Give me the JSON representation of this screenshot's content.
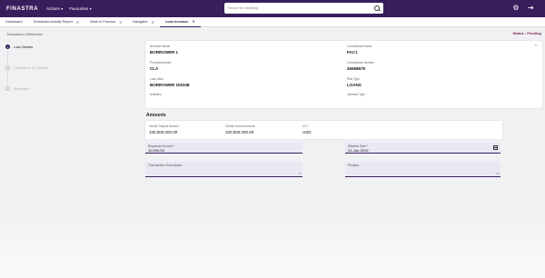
{
  "app": {
    "logo": "FINASTRA"
  },
  "topnav": {
    "actions_label": "Actions",
    "favourites_label": "Favourites",
    "search_placeholder": "Search for Anything",
    "settings_icon": "gear-icon",
    "logout_icon": "logout-icon"
  },
  "tabs": [
    {
      "label": "Dashboard",
      "closable": false
    },
    {
      "label": "Scheduled Activity Report",
      "closable": true
    },
    {
      "label": "Work In Process",
      "closable": true
    },
    {
      "label": "Navigator",
      "closable": true
    },
    {
      "label": "Loan Increase",
      "closable": true,
      "active": true
    }
  ],
  "subheader": {
    "reference": "Transaction Reference",
    "status": "Status : Pending"
  },
  "stepper": [
    {
      "number": "1",
      "label": "Loan Details",
      "active": true
    },
    {
      "number": "2",
      "label": "Confirms & GL Entries",
      "active": false
    },
    {
      "number": "3",
      "label": "Summary",
      "active": false
    }
  ],
  "loan_details": {
    "borrower_name_label": "Borrower Name",
    "borrower_name": "BORROWER 1",
    "commitment_name_label": "Commitment Name",
    "commitment_name": "FAC1",
    "processing_area_label": "Processing Area",
    "processing_area": "CLA",
    "commitment_number_label": "Commitment Number",
    "commitment_number": "46568679",
    "loan_alias_label": "Loan Alias",
    "loan_alias": "BORROWER 100348",
    "risk_type_label": "Risk Type",
    "risk_type": "LOANS",
    "activities_label": "Activities",
    "increase_type_label": "Increase Type"
  },
  "amounts": {
    "title": "Amounts",
    "global_original_label": "Global Original Amount",
    "global_original": "100,000,000.00",
    "global_current_label": "Global Current Amount",
    "global_current": "100,000,000.00",
    "ccy_label": "CCY",
    "ccy": "USD"
  },
  "form": {
    "requested_amount_label": "Requested Amount *",
    "requested_amount": "10,000.00",
    "effective_date_label": "Effective Date *",
    "effective_date": "24-Jun-2019",
    "transaction_description_label": "Transaction Description",
    "reason_label": "Reason"
  }
}
